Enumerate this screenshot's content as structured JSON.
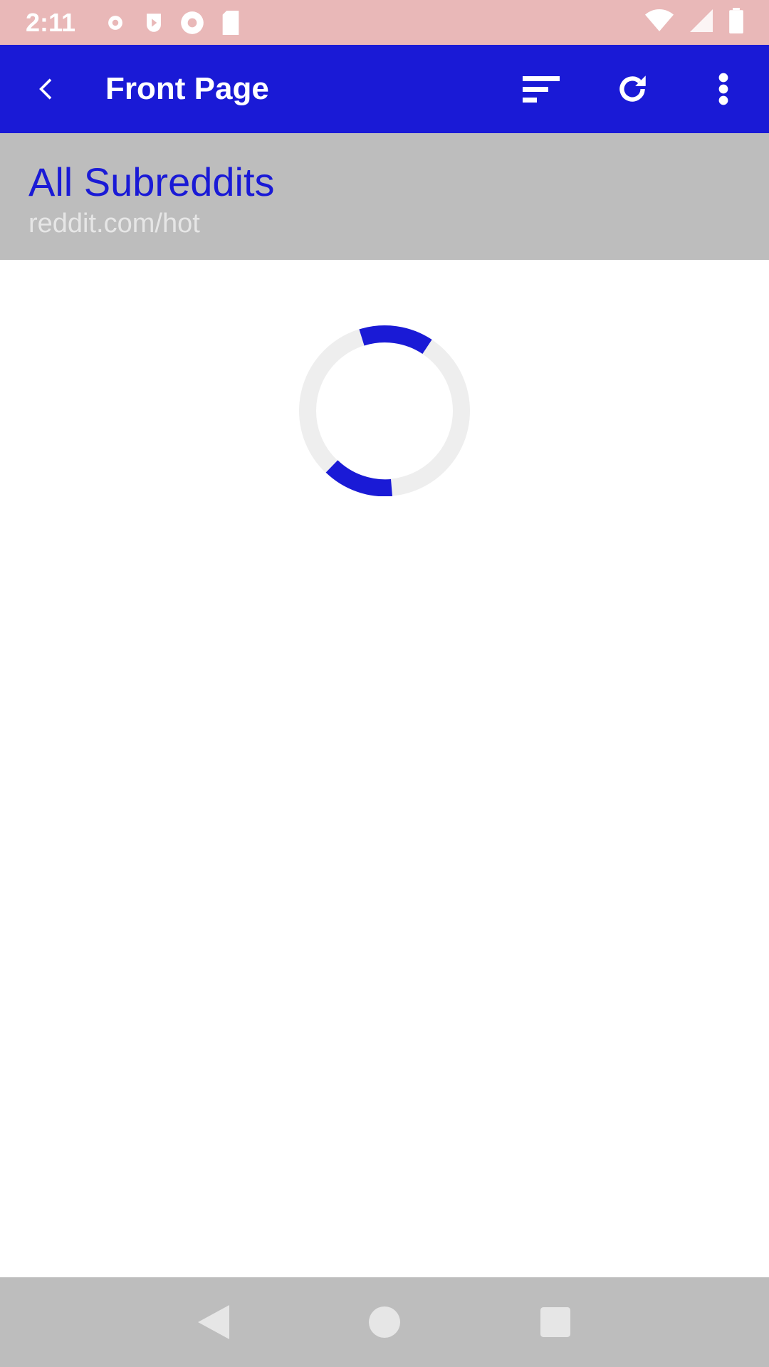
{
  "status_bar": {
    "time": "2:11",
    "left_icons": [
      "settings-icon",
      "shield-icon",
      "sync-icon",
      "sd-card-icon"
    ],
    "right_icons": [
      "wifi-icon",
      "signal-icon",
      "battery-icon"
    ]
  },
  "toolbar": {
    "back_icon": "arrow-back-icon",
    "title": "Front Page",
    "actions": [
      "sort-icon",
      "refresh-icon",
      "more-vert-icon"
    ]
  },
  "header": {
    "title": "All Subreddits",
    "subtitle": "reddit.com/hot"
  },
  "content": {
    "loading": true
  },
  "nav_bar": {
    "buttons": [
      "back-triangle-icon",
      "home-circle-icon",
      "recents-square-icon"
    ]
  },
  "colors": {
    "status_bar": "#e9b8b8",
    "toolbar": "#1a1ad6",
    "header": "#bdbdbd",
    "accent": "#1a1ad6",
    "nav_bar": "#bdbdbd"
  }
}
